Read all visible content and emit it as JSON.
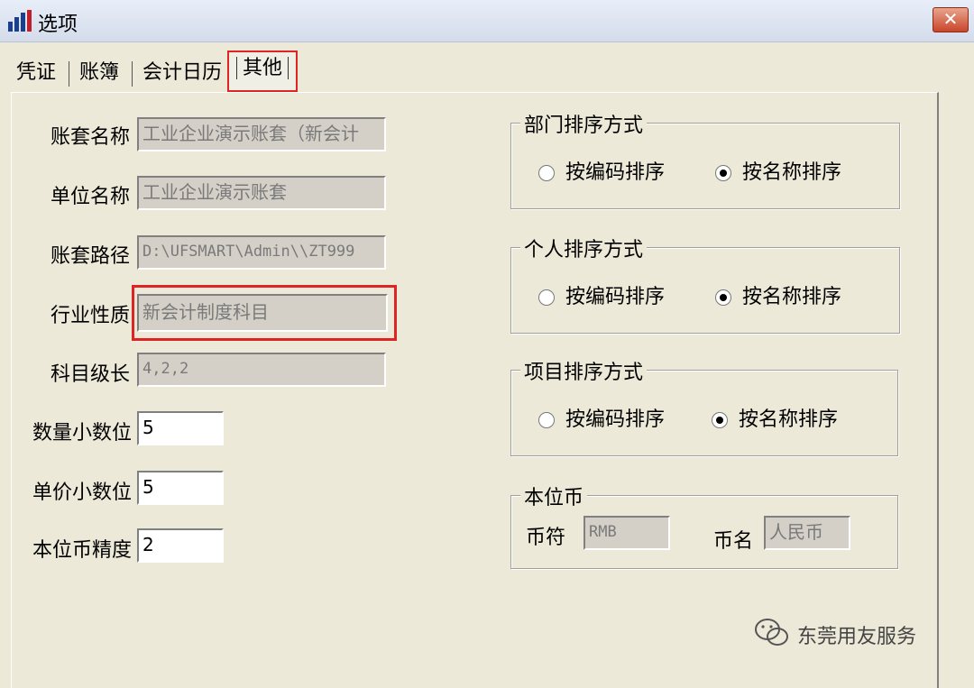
{
  "window": {
    "title": "选项",
    "close_label": "✕"
  },
  "tabs": [
    {
      "label": "凭证"
    },
    {
      "label": "账簿"
    },
    {
      "label": "会计日历"
    },
    {
      "label": "其他"
    }
  ],
  "fields": {
    "account_set_name": {
      "label": "账套名称",
      "value": "工业企业演示账套（新会计"
    },
    "unit_name": {
      "label": "单位名称",
      "value": "工业企业演示账套"
    },
    "account_path": {
      "label": "账套路径",
      "value": "D:\\UFSMART\\Admin\\\\ZT999"
    },
    "industry": {
      "label": "行业性质",
      "value": "新会计制度科目"
    },
    "subject_levels": {
      "label": "科目级长",
      "value": "4,2,2"
    },
    "qty_decimals": {
      "label": "数量小数位",
      "value": "5"
    },
    "price_decimals": {
      "label": "单价小数位",
      "value": "5"
    },
    "currency_precision": {
      "label": "本位币精度",
      "value": "2"
    }
  },
  "groups": {
    "dept_sort": {
      "title": "部门排序方式",
      "opt1": "按编码排序",
      "opt2": "按名称排序",
      "selected": "opt2"
    },
    "person_sort": {
      "title": "个人排序方式",
      "opt1": "按编码排序",
      "opt2": "按名称排序",
      "selected": "opt2"
    },
    "item_sort": {
      "title": "项目排序方式",
      "opt1": "按编码排序",
      "opt2": "按名称排序",
      "selected": "opt2"
    },
    "base_currency": {
      "title": "本位币",
      "symbol_label": "币符",
      "symbol_value": "RMB",
      "name_label": "币名",
      "name_value": "人民币"
    }
  },
  "watermark": {
    "text": "东莞用友服务"
  },
  "colors": {
    "highlight": "#e02424",
    "background": "#ece9d8"
  }
}
